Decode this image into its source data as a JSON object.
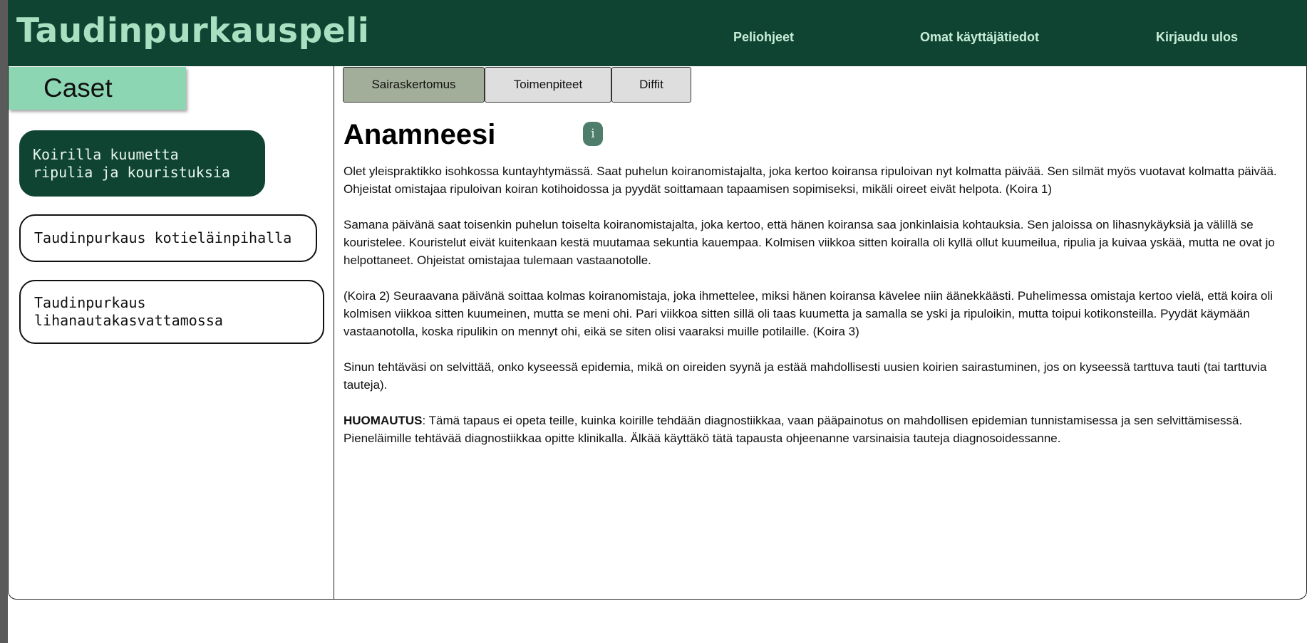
{
  "header": {
    "title": "Taudinpurkauspeli",
    "nav": [
      "Peliohjeet",
      "Omat käyttäjätiedot",
      "Kirjaudu ulos"
    ]
  },
  "sidebar": {
    "tab_label": "Caset",
    "cases": [
      {
        "label": "Koirilla kuumetta\nripulia ja kouristuksia",
        "active": true
      },
      {
        "label": "Taudinpurkaus kotieläinpihalla",
        "active": false
      },
      {
        "label": "Taudinpurkaus\nlihanautakasvattamossa",
        "active": false
      }
    ]
  },
  "main": {
    "tabs": [
      {
        "label": "Sairaskertomus",
        "active": true
      },
      {
        "label": "Toimenpiteet",
        "active": false
      },
      {
        "label": "Diffit",
        "active": false
      }
    ],
    "heading": "Anamneesi",
    "info_icon": "i",
    "paragraphs": [
      "Olet yleispraktikko isohkossa kuntayhtymässä. Saat puhelun koiranomistajalta, joka kertoo koiransa ripuloivan nyt kolmatta päivää. Sen silmät myös vuotavat kolmatta päivää. Ohjeistat omistajaa ripuloivan koiran kotihoidossa ja pyydät soittamaan tapaamisen sopimiseksi, mikäli oireet eivät helpota. (Koira 1)",
      "Samana päivänä saat toisenkin puhelun toiselta koiranomistajalta, joka kertoo, että hänen koiransa saa jonkinlaisia kohtauksia. Sen jaloissa on lihasnykäyksiä ja välillä se kouristelee. Kouristelut eivät kuitenkaan kestä muutamaa sekuntia kauempaa. Kolmisen viikkoa sitten koiralla oli kyllä ollut kuumeilua, ripulia ja kuivaa yskää, mutta ne ovat jo helpottaneet. Ohjeistat omistajaa tulemaan vastaanotolle.",
      "(Koira 2) Seuraavana päivänä soittaa kolmas koiranomistaja, joka ihmettelee, miksi hänen koiransa kävelee niin äänekkäästi. Puhelimessa omistaja kertoo vielä, että koira oli kolmisen viikkoa sitten kuumeinen, mutta se meni ohi. Pari viikkoa sitten sillä oli taas kuumetta ja samalla se yski ja ripuloikin, mutta toipui kotikonsteilla. Pyydät käymään vastaanotolla, koska ripulikin on mennyt ohi, eikä se siten olisi vaaraksi muille potilaille. (Koira 3)",
      "Sinun tehtäväsi on selvittää, onko kyseessä epidemia, mikä on oireiden syynä ja estää mahdollisesti uusien koirien sairastuminen, jos on kyseessä tarttuva tauti (tai tarttuvia tauteja)."
    ],
    "note_label": "HUOMAUTUS",
    "note_text": ": Tämä tapaus ei opeta teille, kuinka koirille tehdään diagnostiikkaa, vaan pääpainotus on mahdollisen epidemian tunnistamisessa ja sen selvittämisessä. Pieneläimille tehtävää diagnostiikkaa opitte klinikalla. Älkää käyttäkö tätä tapausta ohjeenanne varsinaisia tauteja diagnosoidessanne."
  },
  "colors": {
    "header_bg": "#0f4432",
    "brand_text": "#a8e0c2",
    "caset_tab_bg": "#8cd6b4",
    "active_case_bg": "#0f4432",
    "active_tab_bg": "#a2ae99",
    "inactive_tab_bg": "#dedede",
    "info_button_bg": "#4f7d6c"
  }
}
